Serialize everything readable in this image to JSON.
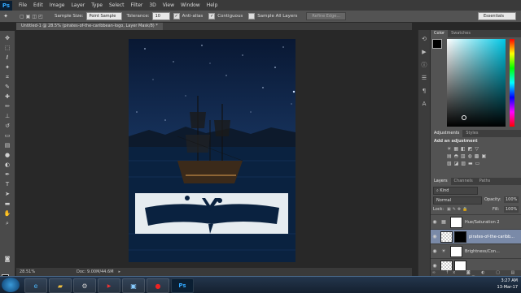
{
  "app": {
    "logo": "Ps"
  },
  "menu": [
    "File",
    "Edit",
    "Image",
    "Layer",
    "Type",
    "Select",
    "Filter",
    "3D",
    "View",
    "Window",
    "Help"
  ],
  "options": {
    "sample_size_label": "Sample Size:",
    "sample_size_value": "Point Sample",
    "tolerance_label": "Tolerance:",
    "tolerance_value": "10",
    "antialias_label": "Anti-alias",
    "contiguous_label": "Contiguous",
    "sample_all_label": "Sample All Layers",
    "refine_edge_label": "Refine Edge...",
    "workspace": "Essentials"
  },
  "document": {
    "tab_title": "Untitled-1 @ 28.5% (pirates-of-the-caribbean-logo, Layer Mask/8) *"
  },
  "status": {
    "zoom": "28.51%",
    "doc_info": "Doc: 9.00M/44.6M"
  },
  "color_panel": {
    "tab_color": "Color",
    "tab_swatches": "Swatches"
  },
  "adjustments_panel": {
    "tab_adjustments": "Adjustments",
    "tab_styles": "Styles",
    "heading": "Add an adjustment"
  },
  "layers_panel": {
    "tab_layers": "Layers",
    "tab_channels": "Channels",
    "tab_paths": "Paths",
    "kind_label": "Kind",
    "blend_mode": "Normal",
    "opacity_label": "Opacity:",
    "opacity_value": "100%",
    "lock_label": "Lock:",
    "fill_label": "Fill:",
    "fill_value": "100%",
    "layers": [
      {
        "name": "Hue/Saturation 2"
      },
      {
        "name": "pirates-of-the-caribb..."
      },
      {
        "name": "Brightness/Con..."
      }
    ]
  },
  "taskbar": {
    "time": "3:27 AM",
    "date": "13-Mar-17"
  },
  "colors": {
    "accent": "#31a8ff",
    "panel": "#535353",
    "menubar": "#3a3a3a"
  }
}
